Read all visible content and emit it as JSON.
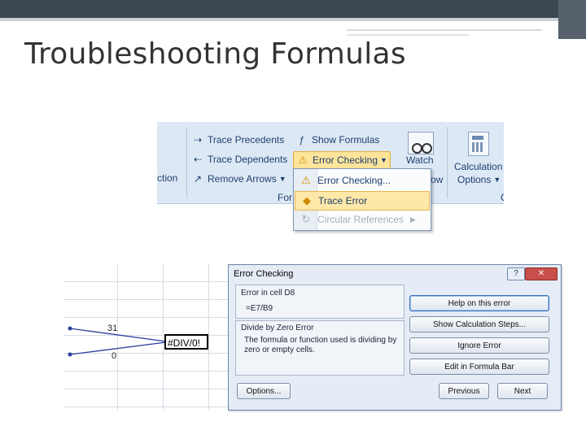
{
  "slide": {
    "title": "Troubleshooting Formulas"
  },
  "ribbon": {
    "partial_left_label": "ction",
    "partial_group_label": "For",
    "partial_far_label": "C",
    "trace_precedents": "Trace Precedents",
    "trace_dependents": "Trace Dependents",
    "remove_arrows": "Remove Arrows",
    "show_formulas": "Show Formulas",
    "error_checking": "Error Checking",
    "watch_window": "Watch",
    "watch_window_line2": "ow",
    "calculation_options": "Calculation",
    "calculation_options_line2": "Options"
  },
  "menu": {
    "items": [
      {
        "label": "Error Checking...",
        "icon": "check-warning-icon"
      },
      {
        "label": "Trace Error",
        "icon": "warning-icon"
      },
      {
        "label": "Circular References",
        "icon": "circular-icon"
      }
    ]
  },
  "sheet": {
    "value_top": "31",
    "value_bottom": "0",
    "error_value": "#DIV/0!"
  },
  "dialog": {
    "title": "Error Checking",
    "error_in_cell": "Error in cell D8",
    "formula": "=E7/B9",
    "error_type": "Divide by Zero Error",
    "description": "The formula or function used is dividing by zero or empty cells.",
    "help_button": "Help on this error",
    "steps_button": "Show Calculation Steps...",
    "ignore_button": "Ignore Error",
    "edit_button": "Edit in Formula Bar",
    "options_button": "Options...",
    "previous_button": "Previous",
    "next_button": "Next"
  }
}
